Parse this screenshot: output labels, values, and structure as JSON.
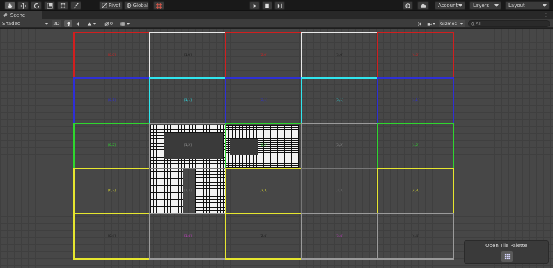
{
  "toolbar": {
    "tools": [
      "hand-tool",
      "move-tool",
      "rotate-tool",
      "scale-tool",
      "rect-tool",
      "transform-tool"
    ],
    "pivot_label": "Pivot",
    "global_label": "Global",
    "account_label": "Account",
    "layers_label": "Layers",
    "layout_label": "Layout"
  },
  "scene_tab": {
    "label": "Scene"
  },
  "scene_toolbar": {
    "shading_mode": "Shaded",
    "mode_2d": "2D",
    "hidden_count": "0",
    "gizmos_label": "Gizmos",
    "search_placeholder": "All"
  },
  "grid": {
    "columns": 5,
    "rows": 5,
    "cells": [
      {
        "label": "[0,0]",
        "border": "#d11f1f",
        "text": "#d11f1f"
      },
      {
        "label": "[1,0]",
        "border": "#e8e8e8",
        "text": "#1a1a1a"
      },
      {
        "label": "[2,0]",
        "border": "#d11f1f",
        "text": "#d11f1f"
      },
      {
        "label": "[3,0]",
        "border": "#e8e8e8",
        "text": "#1a1a1a"
      },
      {
        "label": "[4,0]",
        "border": "#d11f1f",
        "text": "#d11f1f"
      },
      {
        "label": "[0,1]",
        "border": "#2f2fd6",
        "text": "#2f2fd6"
      },
      {
        "label": "[1,1]",
        "border": "#30e6ee",
        "text": "#30e6ee"
      },
      {
        "label": "[2,1]",
        "border": "#2f2fd6",
        "text": "#2f2fd6"
      },
      {
        "label": "[3,1]",
        "border": "#30e6ee",
        "text": "#30e6ee"
      },
      {
        "label": "[4,1]",
        "border": "#2f2fd6",
        "text": "#2f2fd6"
      },
      {
        "label": "[0,2]",
        "border": "#2fd62f",
        "text": "#2fd62f"
      },
      {
        "label": "[1,2]",
        "border": "#9a9a9a",
        "text": "#9a9a9a"
      },
      {
        "label": "[2,2]",
        "border": "#2fd62f",
        "text": "#2fd62f"
      },
      {
        "label": "[3,2]",
        "border": "#9a9a9a",
        "text": "#9a9a9a"
      },
      {
        "label": "[4,2]",
        "border": "#2fd62f",
        "text": "#2fd62f"
      },
      {
        "label": "[0,3]",
        "border": "#e6e62f",
        "text": "#e6e62f"
      },
      {
        "label": "[1,3]",
        "border": "#777777",
        "text": "#777777"
      },
      {
        "label": "[2,3]",
        "border": "#e6e62f",
        "text": "#e6e62f"
      },
      {
        "label": "[3,3]",
        "border": "#777777",
        "text": "#777777"
      },
      {
        "label": "[4,3]",
        "border": "#e6e62f",
        "text": "#e6e62f"
      },
      {
        "label": "[0,4]",
        "border": "#e6e62f",
        "text": "#1a1a1a"
      },
      {
        "label": "[1,4]",
        "border": "#9a9a9a",
        "text": "#c43cc4"
      },
      {
        "label": "[2,4]",
        "border": "#e6e62f",
        "text": "#1a1a1a"
      },
      {
        "label": "[3,4]",
        "border": "#9a9a9a",
        "text": "#c43cc4"
      },
      {
        "label": "[4,4]",
        "border": "#9a9a9a",
        "text": "#1a1a1a"
      }
    ]
  },
  "tile_palette": {
    "label": "Open Tile Palette"
  }
}
